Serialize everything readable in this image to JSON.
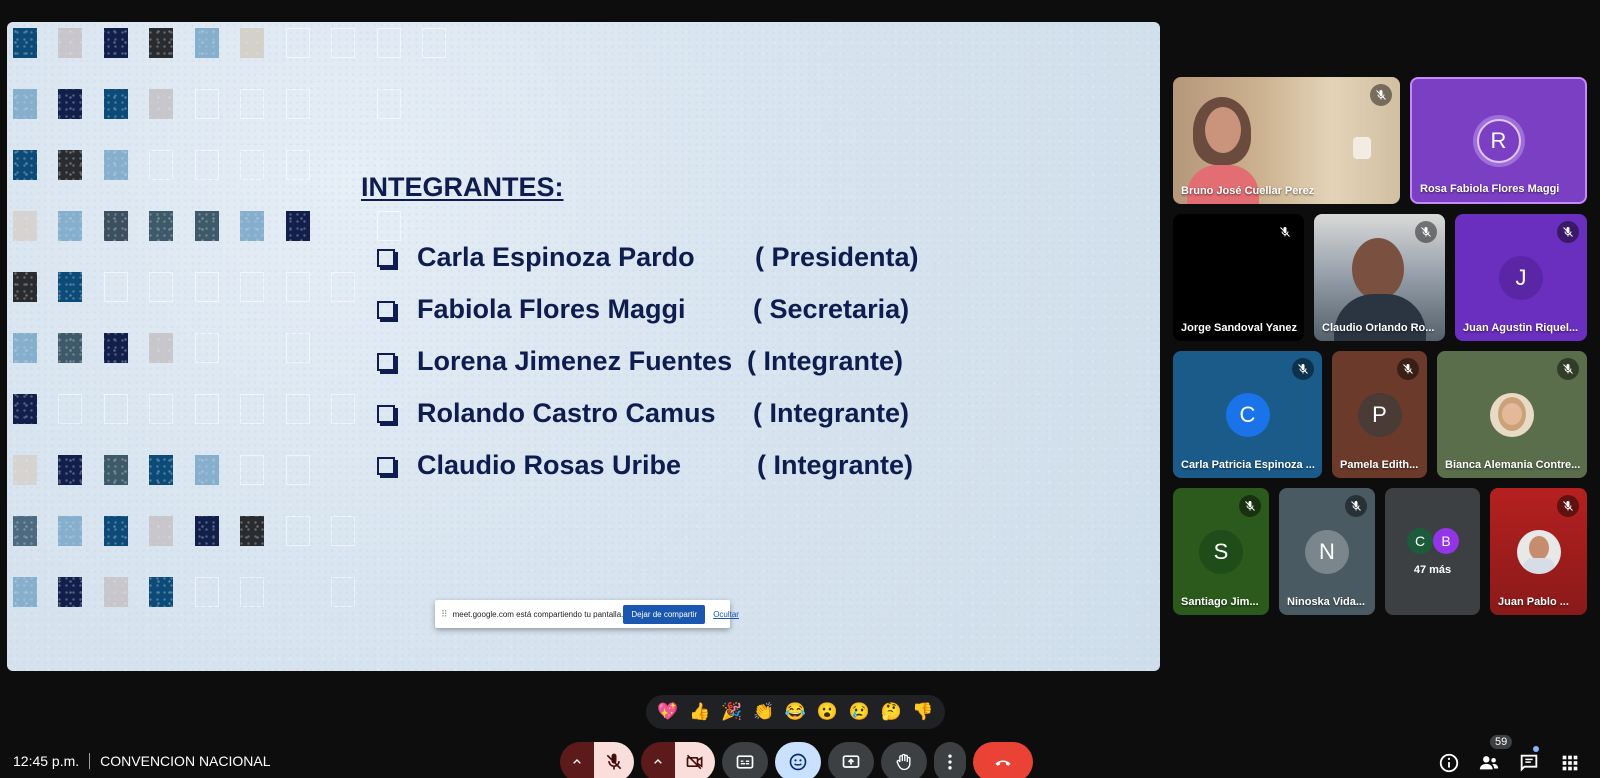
{
  "slide": {
    "heading": "INTEGRANTES:",
    "members": [
      {
        "name": "Carla Espinoza Pardo",
        "role": "( Presidenta)"
      },
      {
        "name": "Fabiola Flores Maggi",
        "role": "( Secretaria)"
      },
      {
        "name": "Lorena Jimenez Fuentes",
        "role": "( Integrante)"
      },
      {
        "name": "Rolando Castro Camus",
        "role": "( Integrante)"
      },
      {
        "name": "Claudio Rosas Uribe",
        "role": "( Integrante)"
      }
    ]
  },
  "share_bar": {
    "message": "meet.google.com está compartiendo tu pantalla.",
    "stop_label": "Dejar de compartir",
    "hide_label": "Ocultar"
  },
  "participants": {
    "p1": {
      "name": "Bruno José Cuellar Perez"
    },
    "p2": {
      "name": "Rosa Fabiola Flores Maggi",
      "initial": "R",
      "color": "#7b3fc4"
    },
    "p3": {
      "name": "Jorge Sandoval Yanez"
    },
    "p4": {
      "name": "Claudio Orlando Ro..."
    },
    "p5": {
      "name": "Juan Agustin Riquel...",
      "initial": "J",
      "color": "#6b2fc0"
    },
    "p6": {
      "name": "Carla Patricia Espinoza ...",
      "initial": "C",
      "color": "#1a73e8"
    },
    "p7": {
      "name": "Pamela Edith...",
      "initial": "P",
      "color": "#5b3a2e"
    },
    "p8": {
      "name": "Bianca Alemania Contre..."
    },
    "p9": {
      "name": "Santiago Jim...",
      "initial": "S",
      "color": "#1e4d1a"
    },
    "p10": {
      "name": "Ninoska Vida...",
      "initial": "N",
      "color": "#5f6b70"
    },
    "more": {
      "label": "47 más",
      "initial_a": "C",
      "initial_b": "B"
    },
    "p11": {
      "name": "Juan Pablo ..."
    }
  },
  "reactions": [
    "💖",
    "👍",
    "🎉",
    "👏",
    "😂",
    "😮",
    "😢",
    "🤔",
    "👎"
  ],
  "bottom": {
    "time": "12:45 p.m.",
    "meeting_name": "CONVENCION NACIONAL",
    "participant_count": "59"
  },
  "colors": {
    "end_call": "#ea4335",
    "active_ctrl": "#c9e0ff",
    "off_ctrl": "#f9dedc",
    "slide_text": "#0f1c4e"
  }
}
